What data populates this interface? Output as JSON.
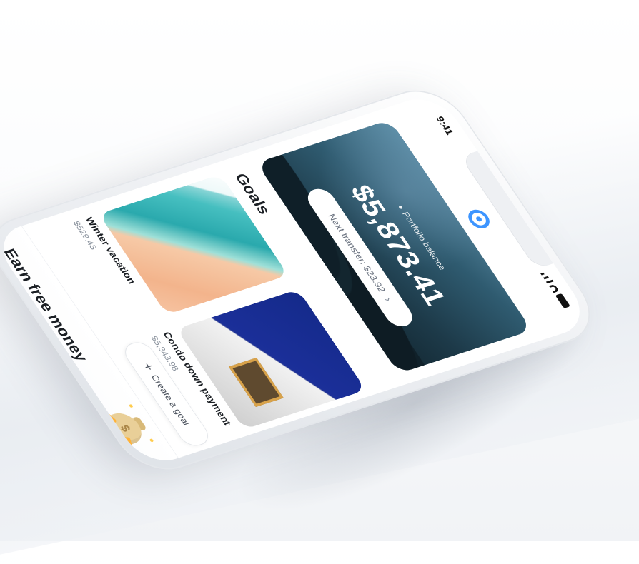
{
  "status_bar": {
    "time": "9:41"
  },
  "balance": {
    "label": "Portfolio balance",
    "amount": "$5,873.41",
    "next_transfer": "Next transfer: $23.92"
  },
  "goals": {
    "title": "Goals",
    "items": [
      {
        "name": "Winter vacation",
        "amount": "$529.43"
      },
      {
        "name": "Condo down payment",
        "amount": "$5,343.98"
      }
    ],
    "create_label": "Create a goal"
  },
  "promo": {
    "title": "Earn free money"
  },
  "colors": {
    "accent": "#3d95ff",
    "text": "#1b1f24",
    "muted": "#8b939e",
    "money": "#ffb238"
  }
}
